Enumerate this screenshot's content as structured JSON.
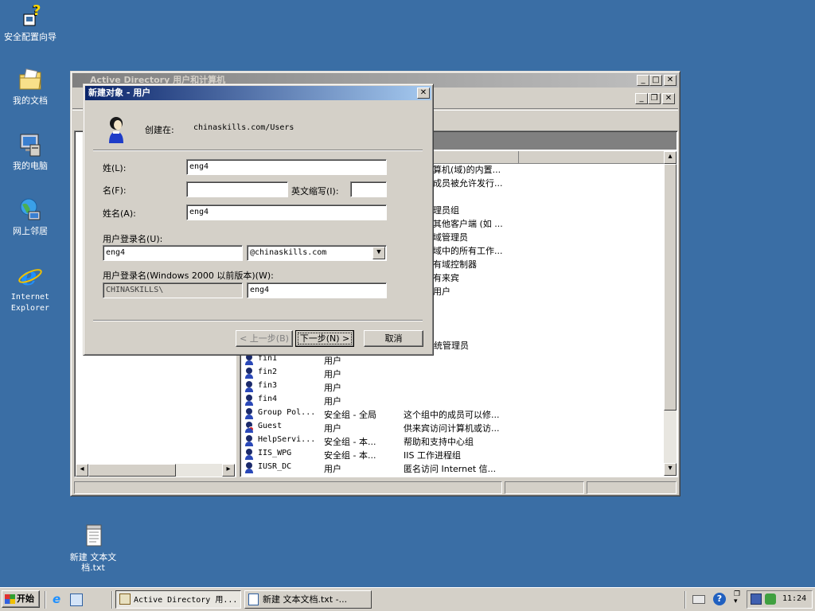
{
  "desktop": {
    "icons": [
      {
        "label": "安全配置向导",
        "icon": "security-wizard-icon"
      },
      {
        "label": "我的文档",
        "icon": "my-documents-icon"
      },
      {
        "label": "我的电脑",
        "icon": "my-computer-icon"
      },
      {
        "label": "网上邻居",
        "icon": "network-places-icon"
      },
      {
        "label": "Internet Explorer",
        "icon": "ie-icon"
      },
      {
        "label": "新建 文本文档.txt",
        "icon": "text-file-icon"
      }
    ]
  },
  "ad_window": {
    "title": "Active Directory 用户和计算机",
    "list_rows_top": [
      {
        "desc": "算机(域)的内置..."
      },
      {
        "desc": "成员被允许发行..."
      },
      {
        "desc": "理员组"
      },
      {
        "desc": "其他客户端 (如 ..."
      },
      {
        "desc": "域管理员"
      },
      {
        "desc": "域中的所有工作..."
      },
      {
        "desc": "有域控制器"
      },
      {
        "desc": "有来宾"
      },
      {
        "desc": "用户"
      },
      {
        "desc": "指定系统管理员"
      }
    ],
    "list_rows": [
      {
        "name": "fin1",
        "type": "用户",
        "desc": ""
      },
      {
        "name": "fin2",
        "type": "用户",
        "desc": ""
      },
      {
        "name": "fin3",
        "type": "用户",
        "desc": ""
      },
      {
        "name": "fin4",
        "type": "用户",
        "desc": ""
      },
      {
        "name": "Group Pol...",
        "type": "安全组 - 全局",
        "desc": "这个组中的成员可以修..."
      },
      {
        "name": "Guest",
        "type": "用户",
        "desc": "供来宾访问计算机或访..."
      },
      {
        "name": "HelpServi...",
        "type": "安全组 - 本...",
        "desc": "帮助和支持中心组"
      },
      {
        "name": "IIS_WPG",
        "type": "安全组 - 本...",
        "desc": "IIS 工作进程组"
      },
      {
        "name": "IUSR_DC",
        "type": "用户",
        "desc": "匿名访问 Internet 信..."
      }
    ]
  },
  "dialog": {
    "title": "新建对象 - 用户",
    "created_in_label": "创建在:",
    "created_in_value": "chinaskills.com/Users",
    "last_name_label": "姓(L):",
    "last_name_value": "eng4",
    "first_name_label": "名(F):",
    "first_name_value": "",
    "initials_label": "英文缩写(I):",
    "initials_value": "",
    "full_name_label": "姓名(A):",
    "full_name_value": "eng4",
    "logon_label": "用户登录名(U):",
    "logon_value": "eng4",
    "domain_value": "@chinaskills.com",
    "pre2000_label": "用户登录名(Windows 2000 以前版本)(W):",
    "pre2000_domain": "CHINASKILLS\\",
    "pre2000_value": "eng4",
    "back_button": "< 上一步(B)",
    "next_button": "下一步(N) >",
    "cancel_button": "取消"
  },
  "taskbar": {
    "start_label": "开始",
    "items": [
      {
        "label": "Active Directory 用...",
        "pressed": true
      },
      {
        "label": "新建 文本文档.txt -...",
        "pressed": false
      }
    ],
    "clock": "11:24"
  }
}
